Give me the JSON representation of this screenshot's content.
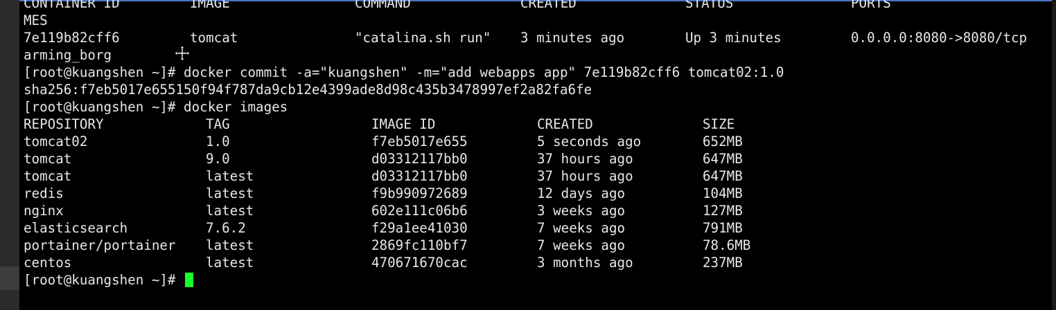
{
  "terminal": {
    "prompt": "[root@kuangshen ~]# ",
    "ps_header": [
      "CONTAINER ID",
      "IMAGE",
      "COMMAND",
      "CREATED",
      "STATUS",
      "PORTS"
    ],
    "ps_header_wrap": "MES",
    "ps_row": [
      "7e119b82cff6",
      "tomcat",
      "\"catalina.sh run\"",
      "3 minutes ago",
      "Up 3 minutes",
      "0.0.0.0:8080->8080/tcp"
    ],
    "ps_row_wrap": "arming_borg",
    "commit_command": "docker commit -a=\"kuangshen\" -m=\"add webapps app\" 7e119b82cff6 tomcat02:1.0",
    "commit_output": "sha256:f7eb5017e655150f94f787da9cb12e4399ade8d98c435b3478997ef2a82fa6fe",
    "images_command": "docker images",
    "images_header": [
      "REPOSITORY",
      "TAG",
      "IMAGE ID",
      "CREATED",
      "SIZE"
    ],
    "images_rows": [
      [
        "tomcat02",
        "1.0",
        "f7eb5017e655",
        "5 seconds ago",
        "652MB"
      ],
      [
        "tomcat",
        "9.0",
        "d03312117bb0",
        "37 hours ago",
        "647MB"
      ],
      [
        "tomcat",
        "latest",
        "d03312117bb0",
        "37 hours ago",
        "647MB"
      ],
      [
        "redis",
        "latest",
        "f9b990972689",
        "12 days ago",
        "104MB"
      ],
      [
        "nginx",
        "latest",
        "602e111c06b6",
        "3 weeks ago",
        "127MB"
      ],
      [
        "elasticsearch",
        "7.6.2",
        "f29a1ee41030",
        "7 weeks ago",
        "791MB"
      ],
      [
        "portainer/portainer",
        "latest",
        "2869fc110bf7",
        "7 weeks ago",
        "78.6MB"
      ],
      [
        "centos",
        "latest",
        "470671670cac",
        "3 months ago",
        "237MB"
      ]
    ]
  },
  "colors": {
    "background": "#000000",
    "text": "#e8e8e8",
    "cursor": "#18ff2a"
  },
  "icons": {
    "mouse": "crosshair-move-cursor-icon"
  }
}
